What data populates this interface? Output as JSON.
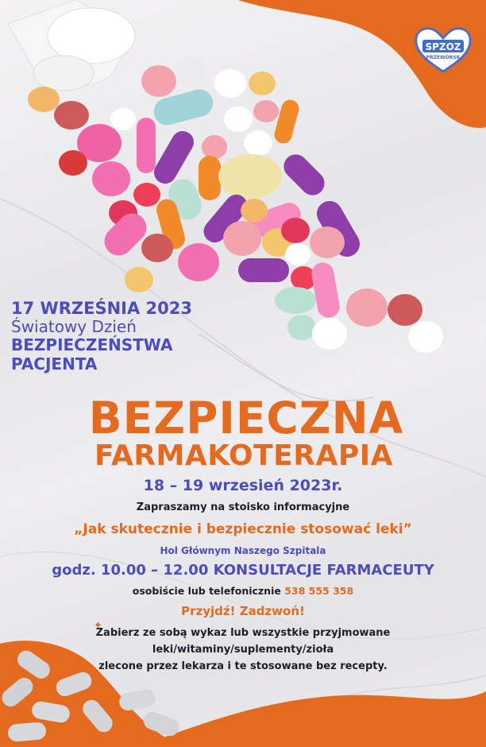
{
  "logo": {
    "line1": "SPZOZ",
    "line2": "PRZEWORSK"
  },
  "event_date": {
    "date": "17 WRZEŚNIA 2023",
    "line2": "Światowy Dzień",
    "line3": "BEZPIECZEŃSTWA",
    "line4": "PACJENTA"
  },
  "title": {
    "main": "BEZPIECZNA",
    "sub": "FARMAKOTERAPIA"
  },
  "details": {
    "dates": "18 – 19 wrzesień 2023r.",
    "invite": "Zapraszamy na stoisko informacyjne",
    "quote": "„Jak skutecznie i bezpiecznie stosować leki”",
    "location": "Hol Głównym Naszego Szpitala",
    "hours": "godz. 10.00 – 12.00 KONSULTACJE FARMACEUTY",
    "phone_prefix": "osobiście lub telefonicznie",
    "phone_number": "538 555 358",
    "call_to_action": "Przyjdź! Zadzwoń!",
    "bring_line1": "Zabierz ze sobą wykaz lub wszystkie przyjmowane",
    "bring_line2": "leki/witaminy/suplementy/zioła",
    "bring_line3": "zlecone przez lekarza i te stosowane bez recepty."
  },
  "colors": {
    "orange": "#e46a1f",
    "blue": "#4c4db7",
    "dark_text": "#1d1d2b",
    "background": "#eeedef"
  }
}
